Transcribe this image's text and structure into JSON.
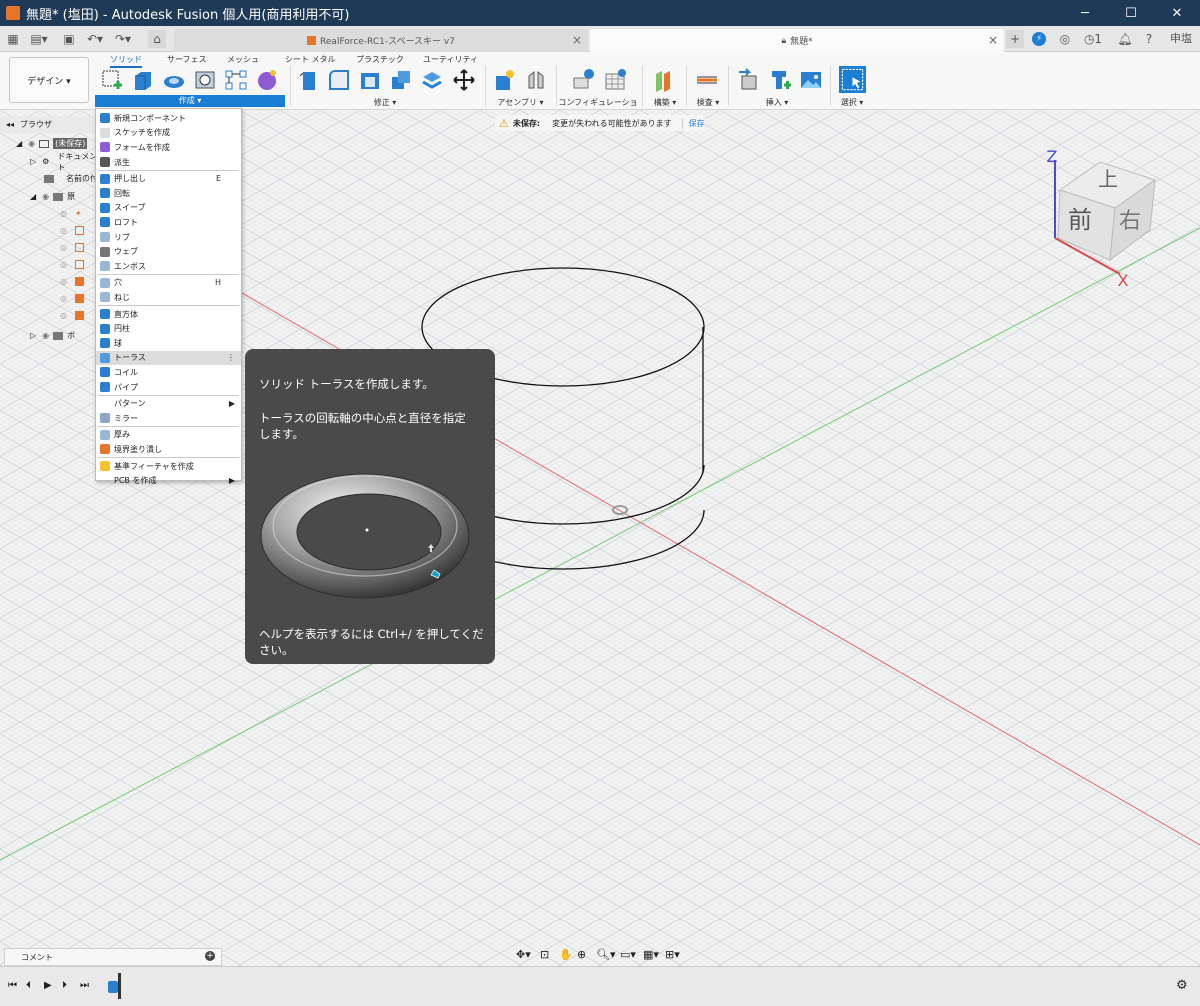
{
  "window": {
    "title": "無題* (塩田) - Autodesk Fusion 個人用(商用利用不可)",
    "minimize": "─",
    "maximize": "☐",
    "close": "✕"
  },
  "tabs": {
    "tab1_label": "RealForce-RC1-スペースキー v7",
    "tab2_label": "無題*",
    "notification_count": "1",
    "user_initials": "申塩"
  },
  "ribbon": {
    "design_label": "デザイン ▾",
    "tabs": [
      "ソリッド",
      "サーフェス",
      "メッシュ",
      "シート メタル",
      "プラスチック",
      "ユーティリティ"
    ],
    "groups": {
      "create": "作成 ▾",
      "modify": "修正 ▾",
      "assemble": "アセンブリ ▾",
      "configure": "コンフィギュレーション ▾",
      "construct": "構築 ▾",
      "inspect": "検査 ▾",
      "insert": "挿入 ▾",
      "select": "選択 ▾"
    }
  },
  "unsaved": {
    "label": "未保存:",
    "message": "変更が失われる可能性があります",
    "save": "保存"
  },
  "browser": {
    "title": "ブラウザ",
    "rows": [
      "(未保存)",
      "ドキュメント",
      "名前の付",
      "原",
      "ボ"
    ]
  },
  "menu": {
    "items": [
      {
        "label": "新規コンポーネント",
        "shortcut": ""
      },
      {
        "label": "スケッチを作成",
        "shortcut": ""
      },
      {
        "label": "フォームを作成",
        "shortcut": ""
      },
      {
        "label": "派生",
        "shortcut": ""
      },
      {
        "label": "押し出し",
        "shortcut": "E"
      },
      {
        "label": "回転",
        "shortcut": ""
      },
      {
        "label": "スイープ",
        "shortcut": ""
      },
      {
        "label": "ロフト",
        "shortcut": ""
      },
      {
        "label": "リブ",
        "shortcut": ""
      },
      {
        "label": "ウェブ",
        "shortcut": ""
      },
      {
        "label": "エンボス",
        "shortcut": ""
      },
      {
        "label": "穴",
        "shortcut": "H"
      },
      {
        "label": "ねじ",
        "shortcut": ""
      },
      {
        "label": "直方体",
        "shortcut": ""
      },
      {
        "label": "円柱",
        "shortcut": ""
      },
      {
        "label": "球",
        "shortcut": ""
      },
      {
        "label": "トーラス",
        "shortcut": ""
      },
      {
        "label": "コイル",
        "shortcut": ""
      },
      {
        "label": "パイプ",
        "shortcut": ""
      },
      {
        "label": "パターン",
        "shortcut": ""
      },
      {
        "label": "ミラー",
        "shortcut": ""
      },
      {
        "label": "厚み",
        "shortcut": ""
      },
      {
        "label": "境界塗り潰し",
        "shortcut": ""
      },
      {
        "label": "基準フィーチャを作成",
        "shortcut": ""
      },
      {
        "label": "PCB を作成",
        "shortcut": ""
      }
    ],
    "more": "⋮"
  },
  "tooltip": {
    "title": "ソリッド トーラスを作成します。",
    "desc_line1": "トーラスの回転軸の中心点と直径を指定",
    "desc_line2": "します。",
    "help_line1": "ヘルプを表示するには Ctrl+/ を押してくだ",
    "help_line2": "さい。"
  },
  "viewcube": {
    "top": "上",
    "front": "前",
    "right": "右",
    "z": "Z",
    "x": "X"
  },
  "comments": {
    "label": "コメント",
    "add": "+"
  },
  "colors": {
    "accent": "#1a7fd4",
    "titlebar": "#1e3a57",
    "grid": "#c4cad1",
    "axis_red": "#e26a6a",
    "axis_green": "#6fcf6f"
  }
}
